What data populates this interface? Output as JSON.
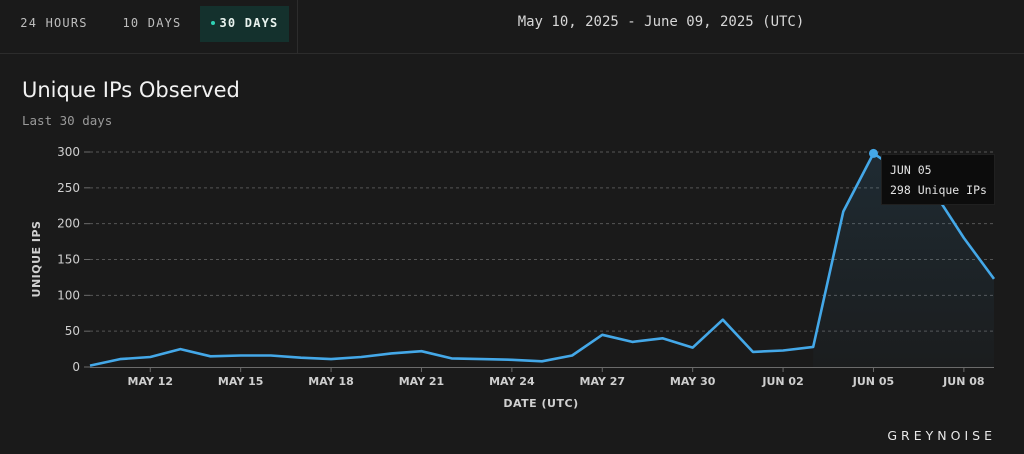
{
  "tabs": [
    {
      "label": "24 HOURS",
      "active": false
    },
    {
      "label": "10 DAYS",
      "active": false
    },
    {
      "label": "30 DAYS",
      "active": true
    }
  ],
  "date_range": "May 10, 2025 - June 09, 2025 (UTC)",
  "chart_title": "Unique IPs Observed",
  "chart_subtitle": "Last 30 days",
  "tooltip": {
    "date": "JUN 05",
    "value_text": "298 Unique IPs"
  },
  "brand": "GREYNOISE",
  "colors": {
    "line": "#44a8e8",
    "accent_dot": "#2fd2b5",
    "active_tab_bg": "#14312d"
  },
  "chart_data": {
    "type": "line",
    "xlabel": "DATE (UTC)",
    "ylabel": "UNIQUE IPS",
    "ylim": [
      0,
      300
    ],
    "yticks": [
      0,
      50,
      100,
      150,
      200,
      250,
      300
    ],
    "grid": true,
    "area_fill_from": "JUN 03",
    "x_tick_labels": [
      "MAY 12",
      "MAY 15",
      "MAY 18",
      "MAY 21",
      "MAY 24",
      "MAY 27",
      "MAY 30",
      "JUN 02",
      "JUN 05",
      "JUN 08"
    ],
    "x": [
      "2025-05-10",
      "2025-05-11",
      "2025-05-12",
      "2025-05-13",
      "2025-05-14",
      "2025-05-15",
      "2025-05-16",
      "2025-05-17",
      "2025-05-18",
      "2025-05-19",
      "2025-05-20",
      "2025-05-21",
      "2025-05-22",
      "2025-05-23",
      "2025-05-24",
      "2025-05-25",
      "2025-05-26",
      "2025-05-27",
      "2025-05-28",
      "2025-05-29",
      "2025-05-30",
      "2025-05-31",
      "2025-06-01",
      "2025-06-02",
      "2025-06-03",
      "2025-06-04",
      "2025-06-05",
      "2025-06-06",
      "2025-06-07",
      "2025-06-08",
      "2025-06-09"
    ],
    "series": [
      {
        "values": [
          2,
          11,
          14,
          25,
          15,
          16,
          16,
          13,
          11,
          14,
          19,
          22,
          12,
          11,
          10,
          8,
          16,
          45,
          35,
          40,
          27,
          66,
          21,
          23,
          28,
          217,
          298,
          270,
          245,
          180,
          123
        ],
        "highlight": "2025-06-05"
      }
    ]
  }
}
